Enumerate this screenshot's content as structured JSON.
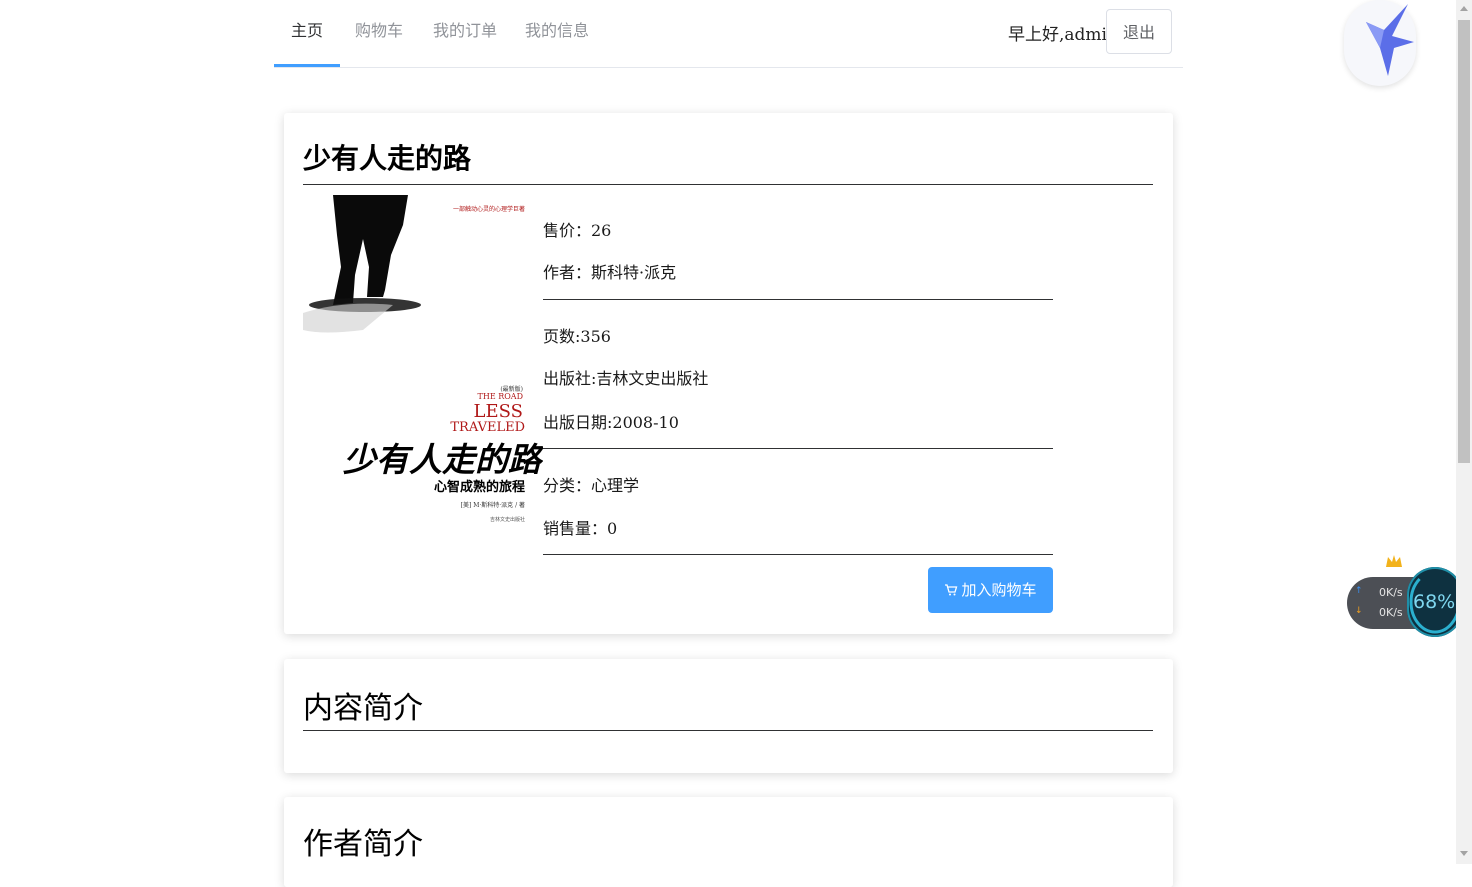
{
  "nav": {
    "items": [
      {
        "label": "主页",
        "active": true
      },
      {
        "label": "购物车",
        "active": false
      },
      {
        "label": "我的订单",
        "active": false
      },
      {
        "label": "我的信息",
        "active": false
      }
    ],
    "greeting": "早上好,admin",
    "logout_label": "退出"
  },
  "book": {
    "title": "少有人走的路",
    "price": "售价：26",
    "author": "作者：斯科特·派克",
    "pages": "页数:356",
    "publisher": "出版社:吉林文史出版社",
    "publish_date": "出版日期:2008-10",
    "category": "分类：心理学",
    "sales": "销售量：0",
    "add_to_cart": "加入购物车",
    "cover": {
      "tag": "一部触动心灵的心理学巨著",
      "edition": "(最新版)",
      "en_line1": "THE ROAD",
      "en_line2": "LESS",
      "en_line3": "TRAVELED",
      "cn_title": "少有人走的路",
      "subtitle": "心智成熟的旅程",
      "credit": "[美] M·斯科特·派克 / 著",
      "publisher_small": "吉林文史出版社"
    }
  },
  "sections": {
    "content_intro": "内容简介",
    "author_intro": "作者简介"
  },
  "widgets": {
    "upload_speed": "0K/s",
    "download_speed": "0K/s",
    "cpu_percent": "68%"
  },
  "colors": {
    "accent": "#409eff",
    "text": "#303133",
    "muted": "#909399"
  }
}
